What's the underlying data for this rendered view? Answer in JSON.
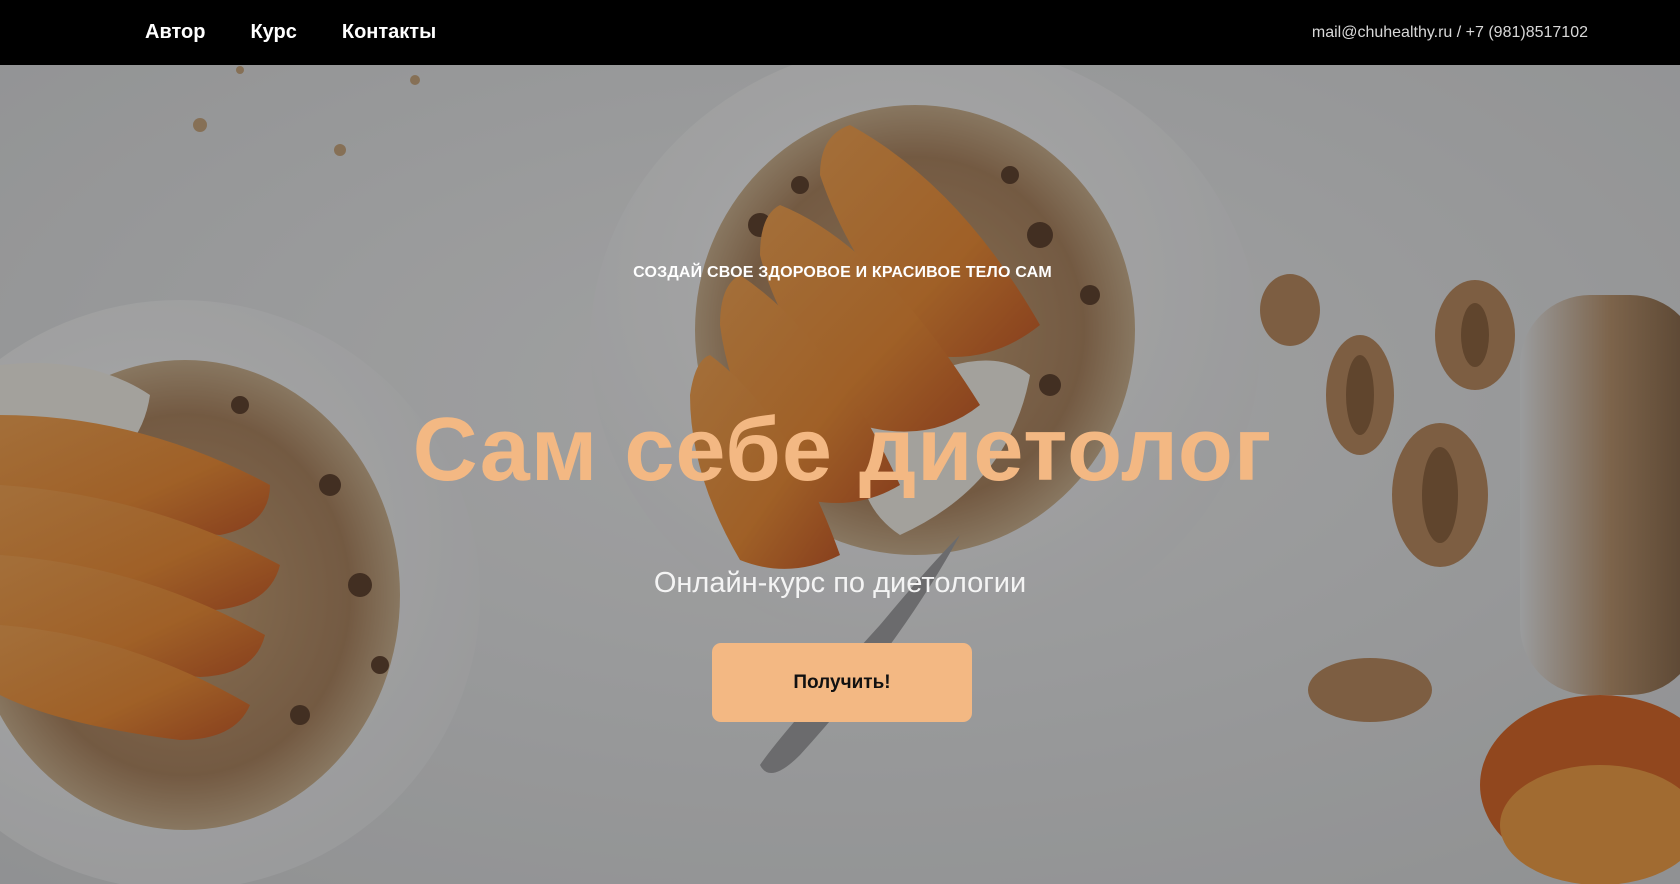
{
  "header": {
    "nav": [
      {
        "label": "Автор"
      },
      {
        "label": "Курс"
      },
      {
        "label": "Контакты"
      }
    ],
    "contacts": "mail@chuhealthy.ru / +7 (981)8517102"
  },
  "hero": {
    "kicker": "СОЗДАЙ СВОЕ ЗДОРОВОЕ И КРАСИВОЕ ТЕЛО САМ",
    "title": "Сам себе диетолог",
    "subtitle": "Онлайн-курс по диетологии",
    "cta_label": "Получить!",
    "background_image": "granola-bowls-with-peach-slices-and-walnuts",
    "colors": {
      "accent": "#f3b883",
      "header_bg": "#000000",
      "overlay": "rgba(30,30,30,0.38)"
    }
  }
}
